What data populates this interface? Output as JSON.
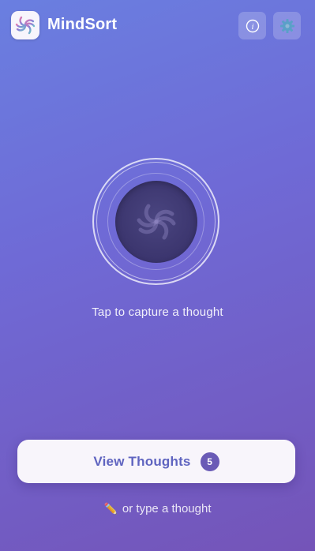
{
  "header": {
    "app_name": "MindSort",
    "logo_icon": "spiral-logo-icon",
    "info_icon": "info-icon",
    "settings_icon": "gear-icon"
  },
  "capture": {
    "hint": "Tap to capture a thought",
    "orb_icon": "spiral-icon"
  },
  "view_thoughts": {
    "label": "View Thoughts",
    "count": "5"
  },
  "type_thought": {
    "icon": "pencil-icon",
    "icon_glyph": "✏️",
    "label": "or type a thought"
  },
  "colors": {
    "accent": "#5f64c0",
    "badge": "#6a5bb6",
    "orb": "#3d3770"
  }
}
